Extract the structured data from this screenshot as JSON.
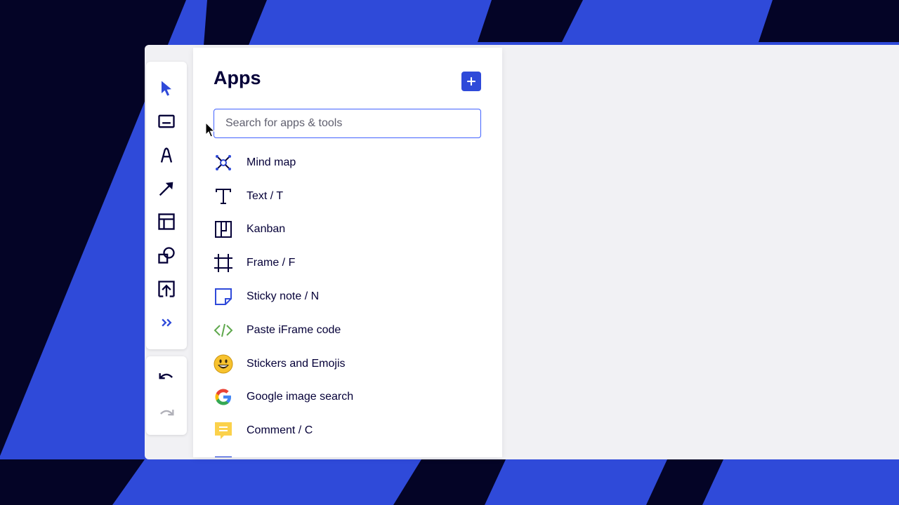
{
  "panel": {
    "title": "Apps",
    "search_placeholder": "Search for apps & tools",
    "search_value": ""
  },
  "apps": [
    {
      "label": "Mind map",
      "icon": "mind-map-icon"
    },
    {
      "label": "Text / T",
      "icon": "text-icon"
    },
    {
      "label": "Kanban",
      "icon": "kanban-icon"
    },
    {
      "label": "Frame / F",
      "icon": "frame-icon"
    },
    {
      "label": "Sticky note / N",
      "icon": "sticky-note-icon"
    },
    {
      "label": "Paste iFrame code",
      "icon": "code-icon"
    },
    {
      "label": "Stickers and Emojis",
      "icon": "emoji-icon"
    },
    {
      "label": "Google image search",
      "icon": "google-icon"
    },
    {
      "label": "Comment / C",
      "icon": "comment-icon"
    }
  ],
  "toolbar": {
    "tools": [
      "select-cursor-icon",
      "text-box-icon",
      "pen-icon",
      "arrow-line-icon",
      "template-icon",
      "shapes-icon",
      "upload-icon",
      "more-tools-icon"
    ],
    "history": [
      "undo-icon",
      "redo-icon"
    ]
  },
  "colors": {
    "accent": "#2f4ad9",
    "background_stripe": "#050538",
    "text": "#050038"
  }
}
